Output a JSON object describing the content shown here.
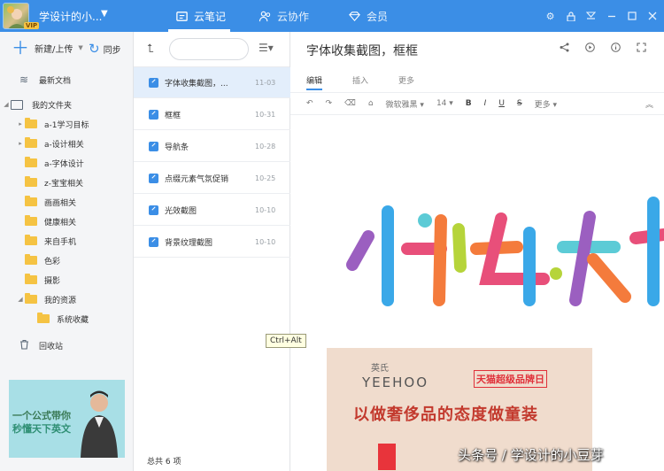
{
  "topbar": {
    "account_name": "学设计的小...",
    "vip_badge": "VIP",
    "tabs": [
      {
        "label": "云笔记",
        "icon": "cloud-note-icon",
        "active": true
      },
      {
        "label": "云协作",
        "icon": "people-icon",
        "active": false
      },
      {
        "label": "会员",
        "icon": "diamond-icon",
        "active": false
      }
    ],
    "window_controls": [
      "settings-icon",
      "lock-icon",
      "skin-icon",
      "minimize-icon",
      "maximize-icon",
      "close-icon"
    ],
    "accent_color": "#3b8ee6"
  },
  "sidebar": {
    "new_upload_label": "新建/上传",
    "sync_label": "同步",
    "recent_label": "最新文档",
    "my_folders_label": "我的文件夹",
    "folders": [
      {
        "label": "a-1学习目标",
        "expandable": true
      },
      {
        "label": "a-设计相关",
        "expandable": true
      },
      {
        "label": "a-字体设计",
        "expandable": false
      },
      {
        "label": "z-宝宝相关",
        "expandable": false
      },
      {
        "label": "画画相关",
        "expandable": false
      },
      {
        "label": "健康相关",
        "expandable": false
      },
      {
        "label": "来自手机",
        "expandable": false
      },
      {
        "label": "色彩",
        "expandable": false
      },
      {
        "label": "摄影",
        "expandable": false
      },
      {
        "label": "我的资源",
        "expandable": true
      },
      {
        "label": "系统收藏",
        "expandable": false
      }
    ],
    "trash_label": "回收站",
    "banner": {
      "line1": "一个公式带你",
      "line2": "秒懂天下英文"
    }
  },
  "notelist": {
    "notes": [
      {
        "title": "字体收集截图，...",
        "date": "11-03",
        "active": true
      },
      {
        "title": "框框",
        "date": "10-31",
        "active": false
      },
      {
        "title": "导航条",
        "date": "10-28",
        "active": false
      },
      {
        "title": "点缀元素气氛促销",
        "date": "10-25",
        "active": false
      },
      {
        "title": "光效截图",
        "date": "10-10",
        "active": false
      },
      {
        "title": "背景纹理截图",
        "date": "10-10",
        "active": false
      }
    ],
    "count_label": "总共 6 项"
  },
  "editor": {
    "title": "字体收集截图，框框",
    "tabs": [
      {
        "label": "编辑",
        "active": true
      },
      {
        "label": "插入",
        "active": false
      },
      {
        "label": "更多",
        "active": false
      }
    ],
    "font_name": "微软雅黑",
    "font_size": "14",
    "more_label": "更多",
    "poster_brand": "YEEHOO",
    "poster_brand_small": "英氏",
    "poster_tmall": "天猫超级品牌日",
    "poster_slogan": "以做奢侈品的态度做童装",
    "colors": {
      "pink": "#e84f7a",
      "orange": "#f47b3c",
      "purple": "#9b5fc0",
      "blue": "#3aa8e8",
      "teal": "#5ccbd6",
      "lime": "#b6d43a"
    }
  },
  "tooltip": "Ctrl+Alt",
  "watermark": "头条号 / 学设计的小豆芽"
}
